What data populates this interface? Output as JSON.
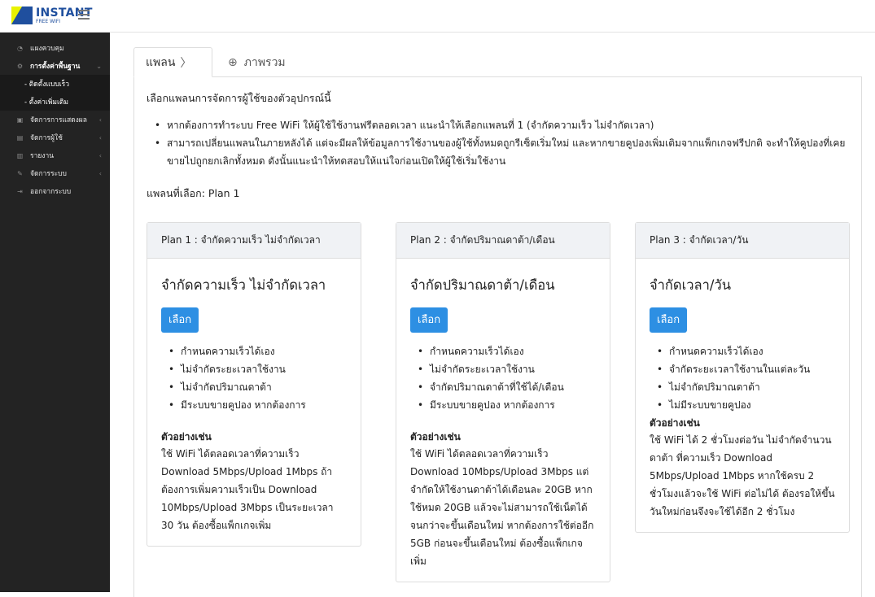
{
  "brand": {
    "title": "INSTANT",
    "subtitle": "FREE WIFI"
  },
  "sidebar": {
    "items": [
      {
        "label": "แผงควบคุม",
        "icon": "dashboard-icon"
      },
      {
        "label": "การตั้งค่าพื้นฐาน",
        "icon": "gear-icon"
      },
      {
        "label": "- ติดตั้งแบบเร็ว"
      },
      {
        "label": "- ตั้งค่าเพิ่มเติม"
      },
      {
        "label": "จัดการการแสดงผล",
        "icon": "image-icon"
      },
      {
        "label": "จัดการผู้ใช้",
        "icon": "user-icon"
      },
      {
        "label": "รายงาน",
        "icon": "chart-icon"
      },
      {
        "label": "จัดการระบบ",
        "icon": "wrench-icon"
      },
      {
        "label": "ออกจากระบบ",
        "icon": "logout-icon"
      }
    ]
  },
  "tabs": {
    "plan": "แพลน",
    "plan_chevron": "〉",
    "overview_icon": "⊕",
    "overview": "ภาพรวม"
  },
  "intro": "เลือกแพลนการจัดการผู้ใช้ของตัวอุปกรณ์นี้",
  "bullets": [
    "หากต้องการทำระบบ Free WiFi ให้ผู้ใช้ใช้งานฟรีตลอดเวลา แนะนำให้เลือกแพลนที่ 1 (จำกัดความเร็ว ไม่จำกัดเวลา)",
    "สามารถเปลี่ยนแพลนในภายหลังได้ แต่จะมีผลให้ข้อมูลการใช้งานของผู้ใช้ทั้งหมดถูกรีเซ็ตเริ่มใหม่ และหากขายคูปองเพิ่มเติมจากแพ็กเกจฟรีปกติ จะทำให้คูปองที่เคยขายไปถูกยกเลิกทั้งหมด ดังนั้นแนะนำให้ทดสอบให้แน่ใจก่อนเปิดให้ผู้ใช้เริ่มใช้งาน"
  ],
  "selected_plan": "แพลนที่เลือก: Plan 1",
  "plans": [
    {
      "header": "Plan 1 : จำกัดความเร็ว ไม่จำกัดเวลา",
      "title": "จำกัดความเร็ว ไม่จำกัดเวลา",
      "button": "เลือก",
      "features": [
        "กำหนดความเร็วได้เอง",
        "ไม่จำกัดระยะเวลาใช้งาน",
        "ไม่จำกัดปริมาณดาต้า",
        "มีระบบขายคูปอง หากต้องการ"
      ],
      "example_title": "ตัวอย่างเช่น",
      "example": "ใช้ WiFi ได้ตลอดเวลาที่ความเร็ว Download 5Mbps/Upload 1Mbps ถ้าต้องการเพิ่มความเร็วเป็น Download 10Mbps/Upload 3Mbps เป็นระยะเวลา 30 วัน ต้องซื้อแพ็กเกจเพิ่ม"
    },
    {
      "header": "Plan 2 : จำกัดปริมาณดาต้า/เดือน",
      "title": "จำกัดปริมาณดาต้า/เดือน",
      "button": "เลือก",
      "features": [
        "กำหนดความเร็วได้เอง",
        "ไม่จำกัดระยะเวลาใช้งาน",
        "จำกัดปริมาณดาต้าที่ใช้ได้/เดือน",
        "มีระบบขายคูปอง หากต้องการ"
      ],
      "example_title": "ตัวอย่างเช่น",
      "example": "ใช้ WiFi ได้ตลอดเวลาที่ความเร็ว Download 10Mbps/Upload 3Mbps แต่จำกัดให้ใช้งานดาต้าได้เดือนละ 20GB หากใช้หมด 20GB แล้วจะไม่สามารถใช้เน็ตได้จนกว่าจะขึ้นเดือนใหม่ หากต้องการใช้ต่ออีก 5GB ก่อนจะขึ้นเดือนใหม่ ต้องซื้อแพ็กเกจเพิ่ม"
    },
    {
      "header": "Plan 3 : จำกัดเวลา/วัน",
      "title": "จำกัดเวลา/วัน",
      "button": "เลือก",
      "features": [
        "กำหนดความเร็วได้เอง",
        "จำกัดระยะเวลาใช้งานในแต่ละวัน",
        "ไม่จำกัดปริมาณดาต้า",
        "ไม่มีระบบขายคูปอง"
      ],
      "example_title": "ตัวอย่างเช่น",
      "example": "ใช้ WiFi ได้ 2 ชั่วโมงต่อวัน ไม่จำกัดจำนวนดาต้า ที่ความเร็ว Download 5Mbps/Upload 1Mbps หากใช้ครบ 2 ชั่วโมงแล้วจะใช้ WiFi ต่อไม่ได้ ต้องรอให้ขึ้นวันใหม่ก่อนจึงจะใช้ได้อีก 2 ชั่วโมง"
    }
  ]
}
